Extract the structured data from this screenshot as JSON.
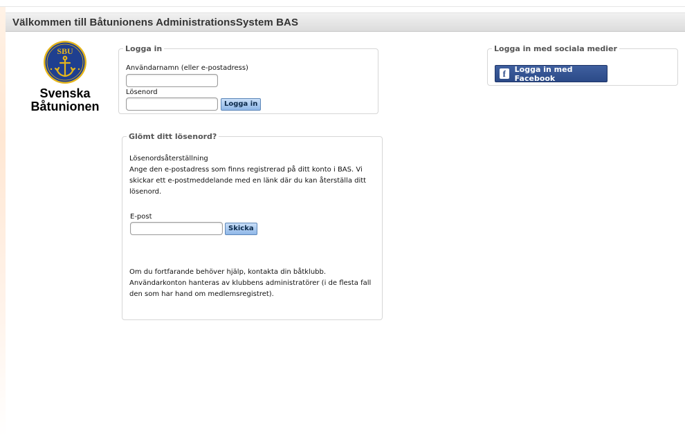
{
  "header": {
    "title": "Välkommen till Båtunionens AdministrationsSystem BAS"
  },
  "logo": {
    "seal_text": "SBU",
    "line1": "Svenska",
    "line2": "Båtunionen"
  },
  "login": {
    "legend": "Logga in",
    "username_label": "Användarnamn (eller e-postadress)",
    "username_value": "",
    "password_label": "Lösenord",
    "password_value": "",
    "submit_label": "Logga in"
  },
  "forgot": {
    "legend": "Glömt ditt lösenord?",
    "heading": "Lösenordsåterställning",
    "description": "Ange den e-postadress som finns registrerad på ditt konto i BAS. Vi skickar ett e-postmeddelande med en länk där du kan återställa ditt lösenord.",
    "email_label": "E-post",
    "email_value": "",
    "submit_label": "Skicka",
    "help_text": "Om du fortfarande behöver hjälp, kontakta din båtklubb. Användarkonton hanteras av klubbens administratörer (i de flesta fall den som har hand om medlemsregistret)."
  },
  "social": {
    "legend": "Logga in med sociala medier",
    "facebook_label": "Logga in med Facebook"
  },
  "colors": {
    "facebook_blue": "#2b4a88",
    "button_blue": "#a9c9f0",
    "seal_blue": "#1f3f8f",
    "seal_gold": "#e4b51c"
  },
  "icons": {
    "facebook": "facebook-icon",
    "logo": "sbu-anchor-seal"
  }
}
